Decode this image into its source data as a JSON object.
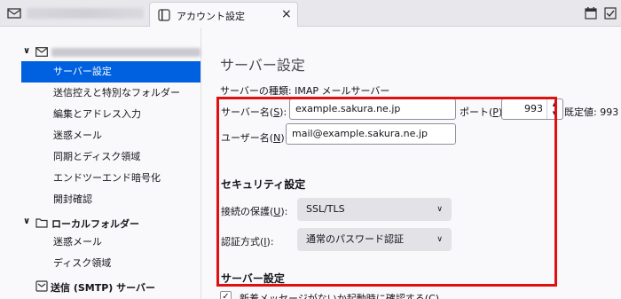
{
  "tab": {
    "title": "アカウント設定",
    "close": "×"
  },
  "sidebar": {
    "items": [
      {
        "label": "サーバー設定"
      },
      {
        "label": "送信控えと特別なフォルダー"
      },
      {
        "label": "編集とアドレス入力"
      },
      {
        "label": "迷惑メール"
      },
      {
        "label": "同期とディスク領域"
      },
      {
        "label": "エンドツーエンド暗号化"
      },
      {
        "label": "開封確認"
      }
    ],
    "local_folder": {
      "label": "ローカルフォルダー"
    },
    "local_items": [
      {
        "label": "迷惑メール"
      },
      {
        "label": "ディスク領域"
      }
    ],
    "smtp": {
      "label": "送信 (SMTP) サーバー"
    }
  },
  "main": {
    "title": "サーバー設定",
    "server_type": "サーバーの種類: IMAP メールサーバー",
    "server_name": {
      "label": "サーバー名(",
      "key": "S",
      "suffix": "):",
      "value": "example.sakura.ne.jp"
    },
    "port": {
      "label": "ポート(",
      "key": "P",
      "suffix": "):",
      "value": "993",
      "default": "既定値: 993"
    },
    "username": {
      "label": "ユーザー名(",
      "key": "N",
      "suffix": "):",
      "value": "mail@example.sakura.ne.jp"
    },
    "security_heading": "セキュリティ設定",
    "connection": {
      "label": "接続の保護(",
      "key": "U",
      "suffix": "):",
      "value": "SSL/TLS"
    },
    "auth": {
      "label": "認証方式(",
      "key": "I",
      "suffix": "):",
      "value": "通常のパスワード認証"
    },
    "server_heading": "サーバー設定",
    "check_on_start": "新着メッセージがないか起動時に確認する(C)"
  },
  "colors": {
    "selected": "#0061e0",
    "highlight": "#e01010"
  }
}
